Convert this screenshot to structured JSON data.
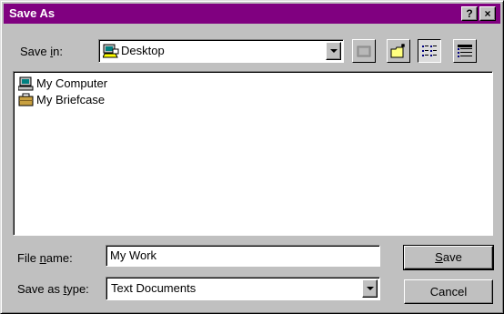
{
  "window": {
    "title": "Save As",
    "help_button": "?",
    "close_button": "×"
  },
  "save_in": {
    "label": "Save in:",
    "value": "Desktop",
    "icon": "desktop-icon"
  },
  "toolbar": {
    "buttons": [
      {
        "name": "up-one-level-icon"
      },
      {
        "name": "new-folder-icon"
      },
      {
        "name": "list-view-icon",
        "pressed": true
      },
      {
        "name": "details-view-icon"
      }
    ]
  },
  "files": [
    {
      "name": "My Computer",
      "icon": "computer-icon"
    },
    {
      "name": "My Briefcase",
      "icon": "briefcase-icon"
    }
  ],
  "file_name": {
    "label": "File name:",
    "value": "My Work"
  },
  "save_as_type": {
    "label": "Save as type:",
    "value": "Text Documents"
  },
  "buttons": {
    "save": "Save",
    "cancel": "Cancel"
  },
  "colors": {
    "titlebar": "#800080",
    "face": "#c0c0c0"
  }
}
